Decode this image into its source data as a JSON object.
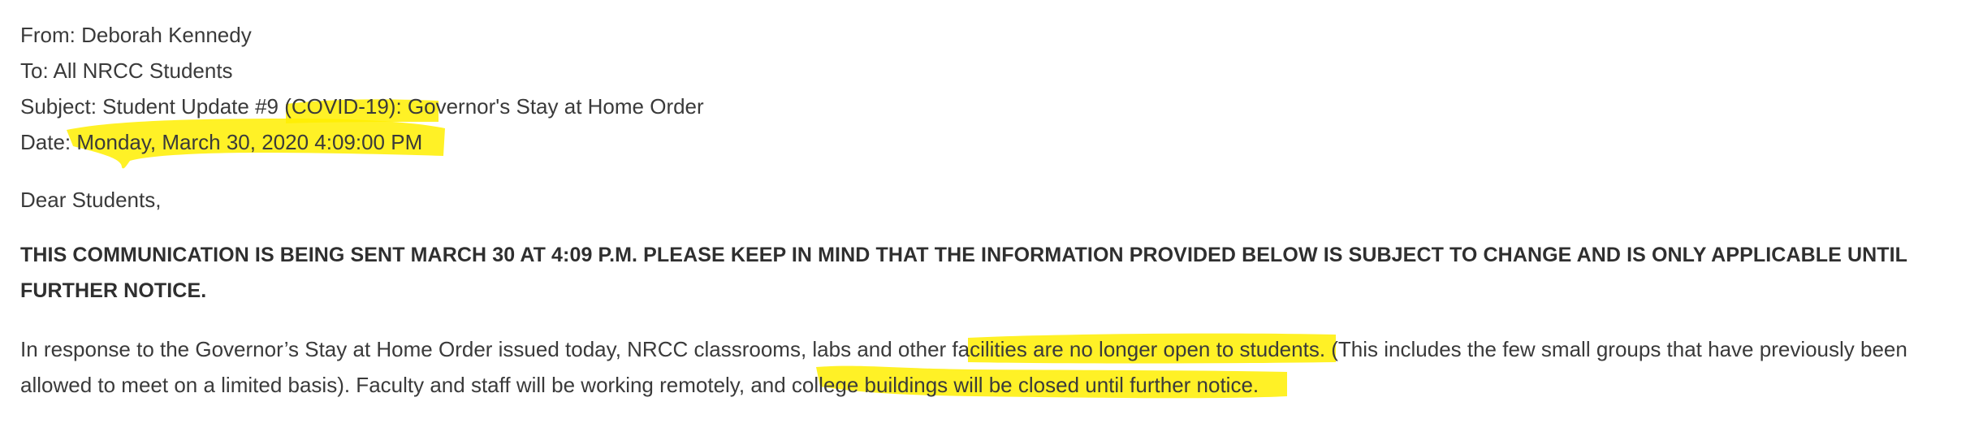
{
  "email": {
    "from_line": "From: Deborah Kennedy",
    "to_line": "To: All NRCC Students",
    "subject_line": "Subject: Student Update #9 (COVID-19): Governor's Stay at Home Order",
    "date_line": "Date: Monday, March 30, 2020 4:09:00 PM"
  },
  "body": {
    "greeting": "Dear Students,",
    "notice_line_1": "THIS COMMUNICATION IS BEING SENT MARCH 30 AT 4:09 P.M. PLEASE KEEP IN MIND THAT THE INFORMATION PROVIDED BELOW IS SUBJECT TO CHANGE AND IS ONLY APPLICABLE UNTIL",
    "notice_line_2": "FURTHER NOTICE.",
    "paragraph_line_1": "In response to the Governor’s Stay at Home Order issued today, NRCC classrooms, labs and other facilities are no longer open to students. (This includes the few small groups that have previously been",
    "paragraph_line_2": "allowed to meet on a limited basis). Faculty and staff will be working remotely, and college buildings will be closed until further notice."
  },
  "colors": {
    "highlighter": "#ffee00",
    "text": "#333333",
    "background": "#ffffff"
  }
}
